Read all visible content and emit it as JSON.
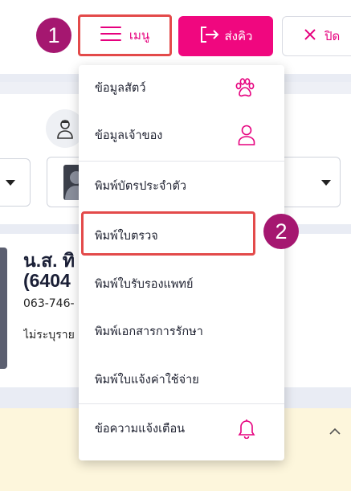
{
  "toolbar": {
    "menu_label": "เมนู",
    "send_queue_label": "ส่งคิว",
    "close_label": "ปิด"
  },
  "steps": [
    "1",
    "2"
  ],
  "patient": {
    "name_line1": "น.ส. ทิ",
    "name_line2": "(6404",
    "phone": "063-746-",
    "note": "ไม่ระบุราย"
  },
  "menu": {
    "items": [
      {
        "label": "ข้อมูลสัตว์",
        "icon": "paw-icon"
      },
      {
        "label": "ข้อมูลเจ้าของ",
        "icon": "person-icon"
      },
      {
        "label": "พิมพ์บัตรประจำตัว"
      },
      {
        "label": "พิมพ์ใบตรวจ"
      },
      {
        "label": "พิมพ์ใบรับรองแพทย์"
      },
      {
        "label": "พิมพ์เอกสารการรักษา"
      },
      {
        "label": "พิมพ์ใบแจ้งค่าใช้จ่าย"
      },
      {
        "label": "ข้อความแจ้งเตือน",
        "icon": "bell-icon"
      }
    ]
  },
  "colors": {
    "accent": "#e6007e",
    "step_badge": "#a51770",
    "highlight_border": "#e34a4a",
    "notice_bg": "#fdf6dc"
  }
}
